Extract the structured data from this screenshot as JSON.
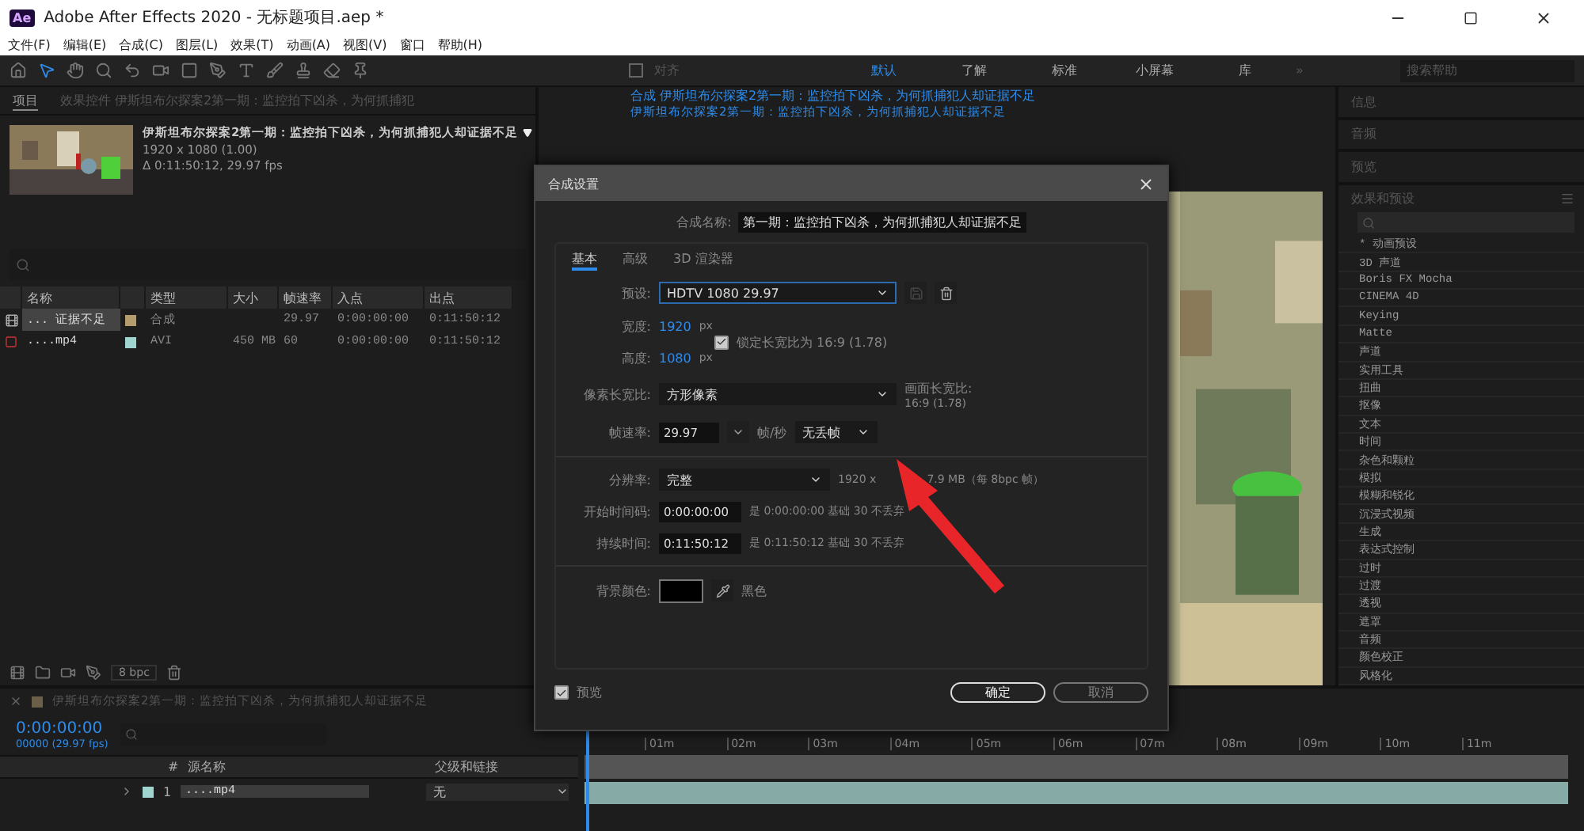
{
  "window": {
    "title": "Adobe After Effects 2020 - 无标题项目.aep *",
    "app_icon": "Ae"
  },
  "menu": [
    "文件(F)",
    "编辑(E)",
    "合成(C)",
    "图层(L)",
    "效果(T)",
    "动画(A)",
    "视图(V)",
    "窗口",
    "帮助(H)"
  ],
  "toolbar": {
    "align": {
      "label": "对齐",
      "checked": false
    },
    "workspaces": [
      {
        "label": "默认",
        "selected": true
      },
      {
        "label": "了解",
        "selected": false
      },
      {
        "label": "标准",
        "selected": false
      },
      {
        "label": "小屏幕",
        "selected": false
      },
      {
        "label": "库",
        "selected": false
      }
    ],
    "more": "»",
    "search": {
      "placeholder": "搜索帮助"
    }
  },
  "project_panel": {
    "tabs": [
      {
        "label": "项目",
        "selected": true
      },
      {
        "label": "效果控件 伊斯坦布尔探案2第一期：监控拍下凶杀，为何抓捕犯",
        "selected": false
      }
    ],
    "footage": {
      "title": "伊斯坦布尔探案2第一期：监控拍下凶杀，为何抓捕犯人却证据不足",
      "size": "1920 x 1080 (1.00)",
      "duration": "Δ 0:11:50:12, 29.97 fps"
    },
    "columns": [
      "名称",
      "类型",
      "大小",
      "帧速率",
      "入点",
      "出点"
    ],
    "rows": [
      {
        "kind": "composition",
        "selected": true,
        "color": "#b59c6c",
        "name": "... 证据不足",
        "type": "合成",
        "fps": "29.97",
        "in": "0:00:00:00",
        "out": "0:11:50:12"
      },
      {
        "kind": "footage",
        "selected": false,
        "color": "#9fd4cf",
        "name": "....mp4",
        "type": "AVI",
        "size": "450 MB",
        "fps": "60",
        "in": "0:00:00:00",
        "out": "0:11:50:12"
      }
    ],
    "bpc": "8 bpc"
  },
  "composition_panel": {
    "tab": "合成 伊斯坦布尔探案2第一期：监控拍下凶杀，为何抓捕犯人却证据不足",
    "breadcrumb": "伊斯坦布尔探案2第一期：监控拍下凶杀，为何抓捕犯人却证据不足"
  },
  "right_panel": {
    "sections": [
      "信息",
      "音频",
      "预览"
    ],
    "effects": {
      "title": "效果和预设",
      "items": [
        "* 动画预设",
        "3D 声道",
        "Boris FX Mocha",
        "CINEMA 4D",
        "Keying",
        "Matte",
        "声道",
        "实用工具",
        "扭曲",
        "抠像",
        "文本",
        "时间",
        "杂色和颗粒",
        "模拟",
        "模糊和锐化",
        "沉浸式视频",
        "生成",
        "表达式控制",
        "过时",
        "过渡",
        "透视",
        "遮罩",
        "音频",
        "颜色校正",
        "风格化"
      ]
    }
  },
  "dialog": {
    "title": "合成设置",
    "name_label": "合成名称:",
    "name_value": "第一期：监控拍下凶杀，为何抓捕犯人却证据不足",
    "tabs": [
      {
        "label": "基本",
        "selected": true
      },
      {
        "label": "高级",
        "selected": false
      },
      {
        "label": "3D 渲染器",
        "selected": false
      }
    ],
    "preset": {
      "label": "预设:",
      "value": "HDTV 1080 29.97"
    },
    "width": {
      "label": "宽度:",
      "value": "1920",
      "unit": "px"
    },
    "height": {
      "label": "高度:",
      "value": "1080",
      "unit": "px"
    },
    "lock": {
      "label": "锁定长宽比为 16:9 (1.78)",
      "checked": true
    },
    "pixel_aspect": {
      "label": "像素长宽比:",
      "value": "方形像素",
      "frame_label": "画面长宽比:",
      "frame_value": "16:9 (1.78)"
    },
    "frame_rate": {
      "label": "帧速率:",
      "value": "29.97",
      "unit": "帧/秒",
      "drop": "无丢帧"
    },
    "resolution": {
      "label": "分辨率:",
      "value": "完整",
      "info_start": "1920 x",
      "info_end": "7.9 MB（每 8bpc 帧）"
    },
    "start": {
      "label": "开始时间码:",
      "value": "0:00:00:00",
      "info": "是 0:00:00:00  基础 30  不丢弃"
    },
    "duration": {
      "label": "持续时间:",
      "value": "0:11:50:12",
      "info": "是 0:11:50:12  基础 30  不丢弃"
    },
    "background": {
      "label": "背景颜色:",
      "color": "#000000",
      "name": "黑色"
    },
    "preview": {
      "label": "预览",
      "checked": true
    },
    "buttons": [
      "确定",
      "取消"
    ]
  },
  "timeline": {
    "tab": "伊斯坦布尔探案2第一期：监控拍下凶杀，为何抓捕犯人却证据不足",
    "timecode": "0:00:00:00",
    "frames": "00000 (29.97 fps)",
    "number_header": "#",
    "source_header": "源名称",
    "parent_header": "父级和链接",
    "ruler": [
      "01m",
      "02m",
      "03m",
      "04m",
      "05m",
      "06m",
      "07m",
      "08m",
      "09m",
      "10m",
      "11m"
    ],
    "layers": [
      {
        "number": "1",
        "name": "....mp4",
        "color": "#9fd4cf",
        "parent": "无"
      }
    ]
  }
}
